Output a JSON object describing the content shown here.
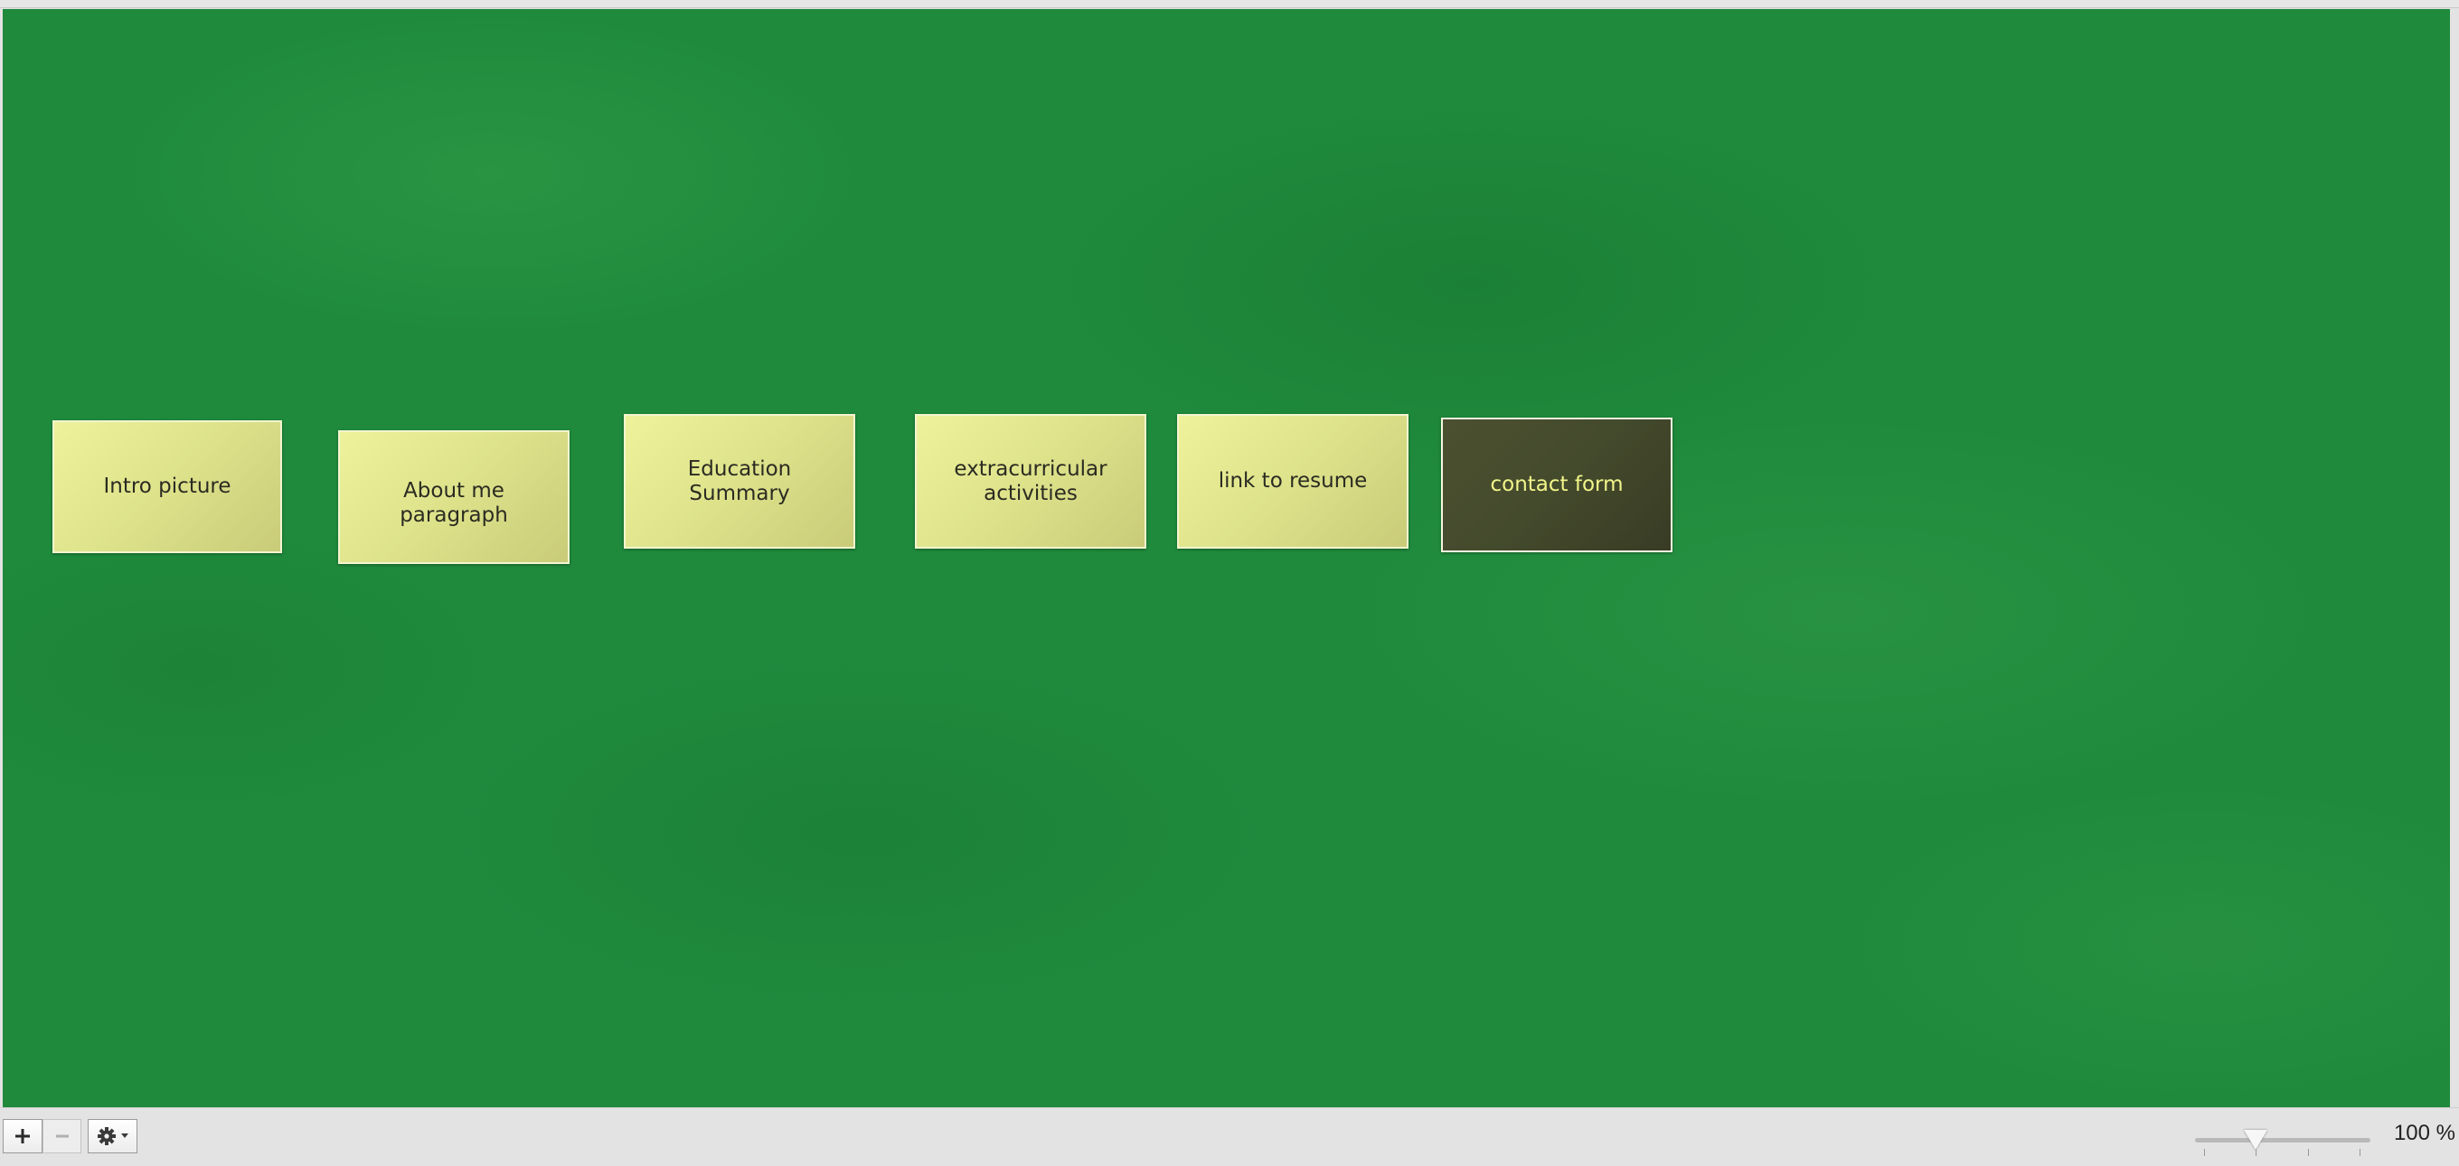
{
  "board": {
    "background_color": "#1f8a3c",
    "notes": [
      {
        "label": "Intro picture",
        "color": "#e5e994",
        "selected": false
      },
      {
        "label": "About me paragraph",
        "color": "#e5e994",
        "selected": false
      },
      {
        "label": "Education Summary",
        "color": "#e5e994",
        "selected": false
      },
      {
        "label": "extracurricular activities",
        "color": "#e5e994",
        "selected": false
      },
      {
        "label": "link to resume",
        "color": "#e5e994",
        "selected": false
      },
      {
        "label": "contact form",
        "color": "#44492c",
        "selected": true
      }
    ]
  },
  "toolbar": {
    "add_icon": "plus-icon",
    "remove_icon": "minus-icon",
    "settings_icon": "gear-icon",
    "zoom": {
      "level_percent": 100,
      "label": "100 %"
    }
  }
}
